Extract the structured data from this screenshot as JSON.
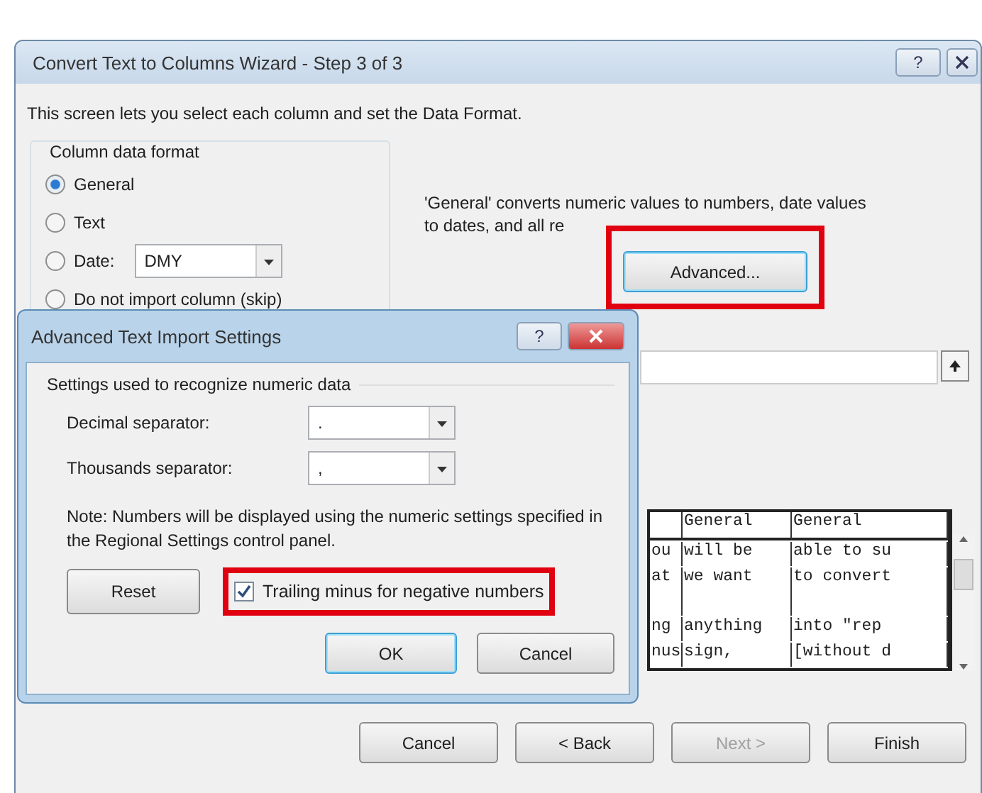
{
  "window": {
    "title": "Convert Text to Columns Wizard - Step 3 of 3",
    "help": "?"
  },
  "intro": "This screen lets you select each column and set the Data Format.",
  "column_format": {
    "label": "Column data format",
    "options": [
      {
        "label": "General",
        "selected": true,
        "kind": "plain"
      },
      {
        "label": "Text",
        "selected": false,
        "kind": "plain"
      },
      {
        "label": "Date:",
        "selected": false,
        "kind": "date",
        "value": "DMY"
      },
      {
        "label": "Do not import column (skip)",
        "selected": false,
        "kind": "plain"
      }
    ]
  },
  "description": [
    "'General' converts numeric values to numbers, date values",
    "to dates, and all re"
  ],
  "advanced_button": "Advanced...",
  "preview": {
    "columns": [
      "",
      "General",
      "General"
    ],
    "rows": [
      [
        "ou",
        "will be",
        "able to su"
      ],
      [
        "at",
        "we want",
        "to convert"
      ],
      [
        "",
        "",
        ""
      ],
      [
        "ng",
        "anything",
        "into \"rep"
      ],
      [
        "nus",
        "sign,",
        "[without d"
      ]
    ]
  },
  "footer_buttons": [
    {
      "label": "Cancel",
      "disabled": false
    },
    {
      "label": "< Back",
      "disabled": false
    },
    {
      "label": "Next >",
      "disabled": true
    },
    {
      "label": "Finish",
      "disabled": false
    }
  ],
  "dialog": {
    "title": "Advanced Text Import Settings",
    "help": "?",
    "group_label": "Settings used to recognize numeric data",
    "fields": [
      {
        "label": "Decimal separator:",
        "value": "."
      },
      {
        "label": "Thousands separator:",
        "value": ","
      }
    ],
    "note": "Note: Numbers will be displayed using the numeric settings specified in the Regional Settings control panel.",
    "reset": "Reset",
    "checkbox": {
      "label": "Trailing minus for negative numbers",
      "checked": true
    },
    "ok": "OK",
    "cancel": "Cancel"
  }
}
